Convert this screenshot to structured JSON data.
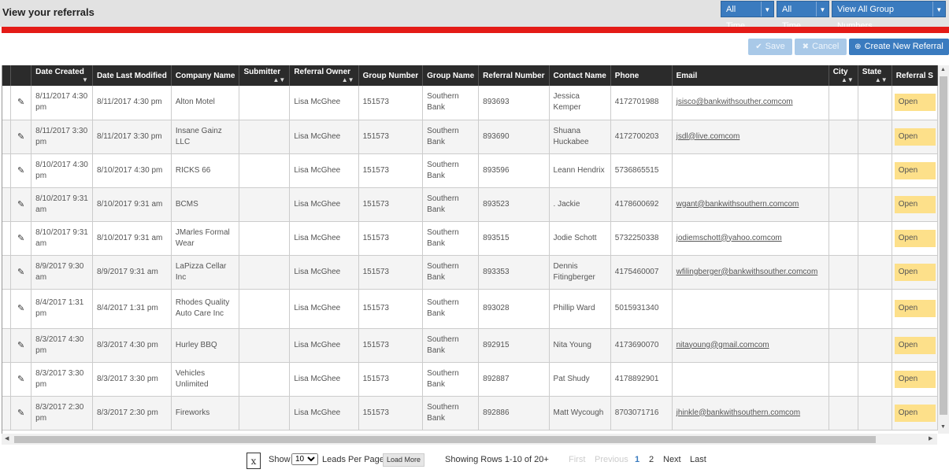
{
  "header": {
    "title": "View your referrals",
    "filters": [
      {
        "label": "All Time"
      },
      {
        "label": "All Time"
      },
      {
        "label": "View All Group Numbers"
      }
    ]
  },
  "actions": {
    "save": "Save",
    "cancel": "Cancel",
    "create": "Create New Referral"
  },
  "columns": [
    "",
    "",
    "Date Created",
    "Date Last Modified",
    "Company Name",
    "Submitter",
    "Referral Owner",
    "Group Number",
    "Group Name",
    "Referral Number",
    "Contact Name",
    "Phone",
    "Email",
    "City",
    "State",
    "Referral S"
  ],
  "rows": [
    {
      "created": "8/11/2017 4:30 pm",
      "modified": "8/11/2017 4:30 pm",
      "company": "Alton Motel",
      "submitter": "",
      "owner": "Lisa McGhee",
      "group_number": "151573",
      "group_name": "Southern Bank",
      "referral_number": "893693",
      "contact": "Jessica Kemper",
      "phone": "4172701988",
      "email": "jsisco@bankwithsouther.comcom",
      "city": "",
      "state": "",
      "status": "Open"
    },
    {
      "created": "8/11/2017 3:30 pm",
      "modified": "8/11/2017 3:30 pm",
      "company": "Insane Gainz LLC",
      "submitter": "",
      "owner": "Lisa McGhee",
      "group_number": "151573",
      "group_name": "Southern Bank",
      "referral_number": "893690",
      "contact": "Shuana Huckabee",
      "phone": "4172700203",
      "email": "jsdl@live.comcom",
      "city": "",
      "state": "",
      "status": "Open"
    },
    {
      "created": "8/10/2017 4:30 pm",
      "modified": "8/10/2017 4:30 pm",
      "company": "RICKS 66",
      "submitter": "",
      "owner": "Lisa McGhee",
      "group_number": "151573",
      "group_name": "Southern Bank",
      "referral_number": "893596",
      "contact": "Leann Hendrix",
      "phone": "5736865515",
      "email": "",
      "city": "",
      "state": "",
      "status": "Open"
    },
    {
      "created": "8/10/2017 9:31 am",
      "modified": "8/10/2017 9:31 am",
      "company": "BCMS",
      "submitter": "",
      "owner": "Lisa McGhee",
      "group_number": "151573",
      "group_name": "Southern Bank",
      "referral_number": "893523",
      "contact": ". Jackie",
      "phone": "4178600692",
      "email": "wgant@bankwithsouthern.comcom",
      "city": "",
      "state": "",
      "status": "Open"
    },
    {
      "created": "8/10/2017 9:31 am",
      "modified": "8/10/2017 9:31 am",
      "company": "JMarles Formal Wear",
      "submitter": "",
      "owner": "Lisa McGhee",
      "group_number": "151573",
      "group_name": "Southern Bank",
      "referral_number": "893515",
      "contact": "Jodie Schott",
      "phone": "5732250338",
      "email": "jodiemschott@yahoo.comcom",
      "city": "",
      "state": "",
      "status": "Open"
    },
    {
      "created": "8/9/2017 9:30 am",
      "modified": "8/9/2017 9:31 am",
      "company": "LaPizza Cellar Inc",
      "submitter": "",
      "owner": "Lisa McGhee",
      "group_number": "151573",
      "group_name": "Southern Bank",
      "referral_number": "893353",
      "contact": "Dennis Fitingberger",
      "phone": "4175460007",
      "email": "wfilingberger@bankwithsouther.comcom",
      "city": "",
      "state": "",
      "status": "Open"
    },
    {
      "created": "8/4/2017 1:31 pm",
      "modified": "8/4/2017 1:31 pm",
      "company": "Rhodes Quality Auto Care Inc",
      "submitter": "",
      "owner": "Lisa McGhee",
      "group_number": "151573",
      "group_name": "Southern Bank",
      "referral_number": "893028",
      "contact": "Phillip Ward",
      "phone": "5015931340",
      "email": "",
      "city": "",
      "state": "",
      "status": "Open"
    },
    {
      "created": "8/3/2017 4:30 pm",
      "modified": "8/3/2017 4:30 pm",
      "company": "Hurley BBQ",
      "submitter": "",
      "owner": "Lisa McGhee",
      "group_number": "151573",
      "group_name": "Southern Bank",
      "referral_number": "892915",
      "contact": "Nita Young",
      "phone": "4173690070",
      "email": "nitayoung@gmail.comcom",
      "city": "",
      "state": "",
      "status": "Open"
    },
    {
      "created": "8/3/2017 3:30 pm",
      "modified": "8/3/2017 3:30 pm",
      "company": "Vehicles Unlimited",
      "submitter": "",
      "owner": "Lisa McGhee",
      "group_number": "151573",
      "group_name": "Southern Bank",
      "referral_number": "892887",
      "contact": "Pat Shudy",
      "phone": "4178892901",
      "email": "",
      "city": "",
      "state": "",
      "status": "Open"
    },
    {
      "created": "8/3/2017 2:30 pm",
      "modified": "8/3/2017 2:30 pm",
      "company": "Fireworks",
      "submitter": "",
      "owner": "Lisa McGhee",
      "group_number": "151573",
      "group_name": "Southern Bank",
      "referral_number": "892886",
      "contact": "Matt Wycough",
      "phone": "8703071716",
      "email": "jhinkle@bankwithsouthern.comcom",
      "city": "",
      "state": "",
      "status": "Open"
    }
  ],
  "pager": {
    "show_label": "Show",
    "per_page_value": "10",
    "per_page_label": "Leads Per Page",
    "load_more": "Load More",
    "showing": "Showing Rows 1-10 of 20+",
    "first": "First",
    "previous": "Previous",
    "page1": "1",
    "page2": "2",
    "next": "Next",
    "last": "Last"
  },
  "icons": {
    "edit": "pencil-icon",
    "save": "check-icon",
    "cancel": "x-icon",
    "create": "plus-circle-icon",
    "export": "excel-icon"
  },
  "colors": {
    "header_bg": "#2b2b2b",
    "red_bar": "#e41b17",
    "primary": "#3a7bbf",
    "status_open": "#fde08a"
  }
}
